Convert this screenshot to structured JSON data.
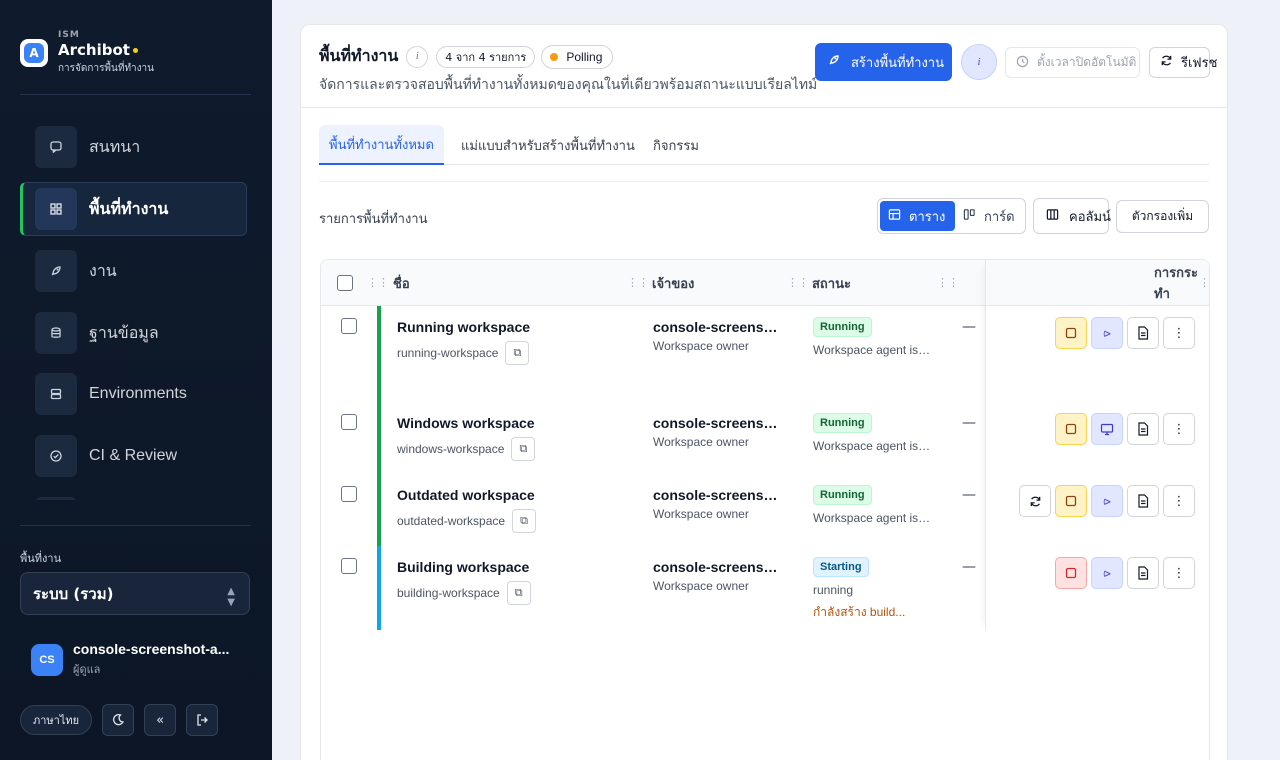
{
  "brand": {
    "small": "ISM",
    "name": "Archibot",
    "subtitle": "การจัดการพื้นที่ทำงาน"
  },
  "nav": [
    {
      "label": "สนทนา",
      "icon": "chat-icon",
      "active": false
    },
    {
      "label": "พื้นที่ทำงาน",
      "icon": "grid-icon",
      "active": true
    },
    {
      "label": "งาน",
      "icon": "rocket-icon",
      "active": false
    },
    {
      "label": "ฐานข้อมูล",
      "icon": "database-icon",
      "active": false
    },
    {
      "label": "Environments",
      "icon": "server-icon",
      "active": false
    },
    {
      "label": "CI & Review",
      "icon": "check-circle-icon",
      "active": false
    }
  ],
  "workspace_selector": {
    "label": "พื้นที่งาน",
    "value": "ระบบ (รวม)"
  },
  "user": {
    "initials": "CS",
    "name": "console-screenshot-a...",
    "role": "ผู้ดูแล"
  },
  "footer": {
    "lang_button": "ภาษาไทย"
  },
  "header": {
    "title": "พื้นที่ทำงาน",
    "count_badge": "4 จาก 4 รายการ",
    "poll_badge": "Polling",
    "description": "จัดการและตรวจสอบพื้นที่ทำงานทั้งหมดของคุณในที่เดียวพร้อมสถานะแบบเรียลไทม์",
    "primary_button": "สร้างพื้นที่ทำงาน",
    "schedule_button": "ตั้งเวลาปิดอัตโนมัติ",
    "refresh_button": "รีเฟรช"
  },
  "tabs": [
    {
      "label": "พื้นที่ทำงานทั้งหมด",
      "active": true
    },
    {
      "label": "แม่แบบสำหรับสร้างพื้นที่ทำงาน",
      "active": false
    },
    {
      "label": "กิจกรรม",
      "active": false
    }
  ],
  "list": {
    "title": "รายการพื้นที่ทำงาน",
    "view_table": "ตาราง",
    "view_cards": "การ์ด",
    "columns_button": "คอลัมน์",
    "more_button": "ตัวกรองเพิ่ม"
  },
  "table": {
    "headers": {
      "name": "ชื่อ",
      "owner": "เจ้าของ",
      "status": "สถานะ",
      "actions": "การกระทำ"
    },
    "rows": [
      {
        "name": "Running workspace",
        "slug": "running-workspace",
        "owner": "console-screenshot-admin",
        "owner_role": "Workspace owner",
        "status": "Running",
        "status_kind": "running",
        "status_detail": "Workspace agent is ready",
        "extra": "—",
        "bar_color": "#16a34a",
        "actions": [
          "stop",
          "vscode",
          "logs",
          "menu"
        ],
        "ide_icon": "vscode-icon"
      },
      {
        "name": "Windows workspace",
        "slug": "windows-workspace",
        "owner": "console-screenshot-admin",
        "owner_role": "Workspace owner",
        "status": "Running",
        "status_kind": "running",
        "status_detail": "Workspace agent is ready",
        "extra": "—",
        "bar_color": "#16a34a",
        "actions": [
          "stop",
          "rdp",
          "logs",
          "menu"
        ],
        "ide_icon": "remote-desktop-icon"
      },
      {
        "name": "Outdated workspace",
        "slug": "outdated-workspace",
        "owner": "console-screenshot-admin",
        "owner_role": "Workspace owner",
        "status": "Running",
        "status_kind": "running",
        "status_detail": "Workspace agent is ready",
        "extra": "—",
        "bar_color": "#16a34a",
        "actions": [
          "update",
          "stop",
          "vscode",
          "logs",
          "menu"
        ],
        "ide_icon": "vscode-icon"
      },
      {
        "name": "Building workspace",
        "slug": "building-workspace",
        "owner": "console-screenshot-admin",
        "owner_role": "Workspace owner",
        "status": "Starting",
        "status_kind": "starting",
        "status_detail": "running",
        "status_warning": "กำลังสร้าง build...",
        "extra": "—",
        "bar_color": "#0ea5e9",
        "actions": [
          "stop-red",
          "vscode",
          "logs",
          "menu"
        ],
        "ide_icon": "vscode-icon"
      }
    ]
  },
  "colors": {
    "accent": "#2563eb",
    "sidebar_bg": "#0f1b2d",
    "running": "#16a34a",
    "starting": "#0ea5e9",
    "polling_dot": "#f59e0b"
  }
}
